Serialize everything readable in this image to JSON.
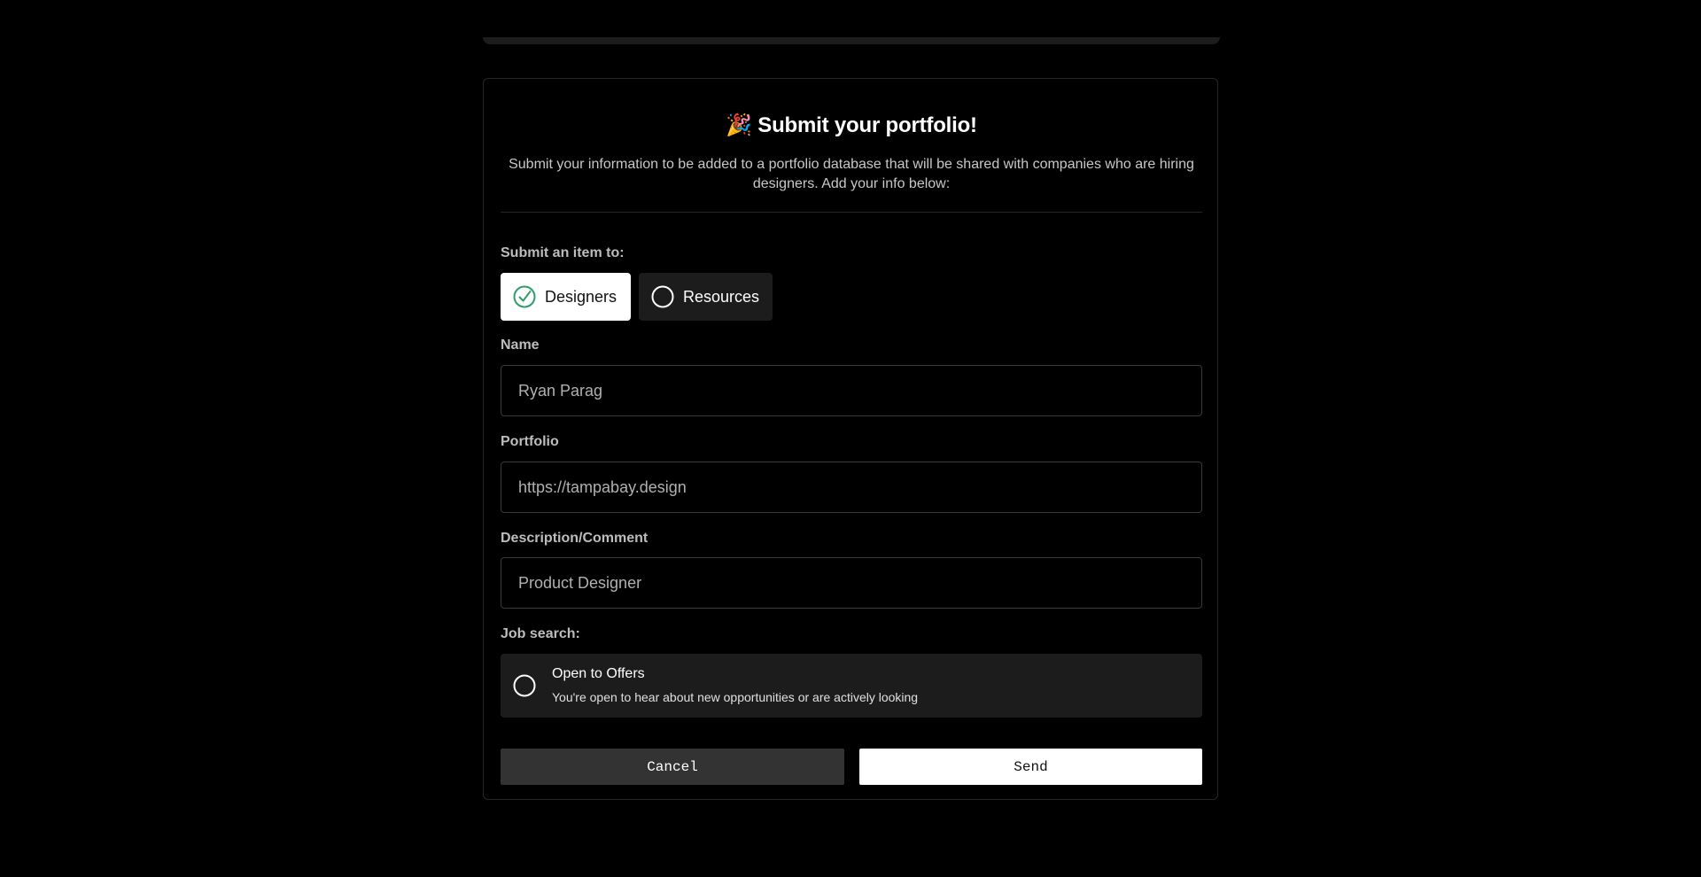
{
  "form": {
    "title_emoji": "🎉",
    "title": "Submit your portfolio!",
    "subtitle": "Submit your information to be added to a portfolio database that will be shared with companies who are hiring designers. Add your info below:",
    "submit_to_label": "Submit an item to:",
    "submit_to_options": [
      {
        "label": "Designers",
        "selected": true,
        "icon": "check-circle-icon"
      },
      {
        "label": "Resources",
        "selected": false,
        "icon": "circle-icon"
      }
    ],
    "name": {
      "label": "Name",
      "placeholder": "Ryan Parag"
    },
    "portfolio": {
      "label": "Portfolio",
      "placeholder": "https://tampabay.design"
    },
    "description": {
      "label": "Description/Comment",
      "placeholder": "Product Designer"
    },
    "job_search": {
      "label": "Job search:",
      "option_title": "Open to Offers",
      "option_description": "You're open to hear about new opportunities or are actively looking",
      "checked": false
    },
    "cancel_label": "Cancel",
    "send_label": "Send"
  },
  "colors": {
    "background": "#000000",
    "check_accent": "#2e9d6a",
    "selected_bg": "#ffffff",
    "unselected_bg": "#1c1c1c"
  }
}
